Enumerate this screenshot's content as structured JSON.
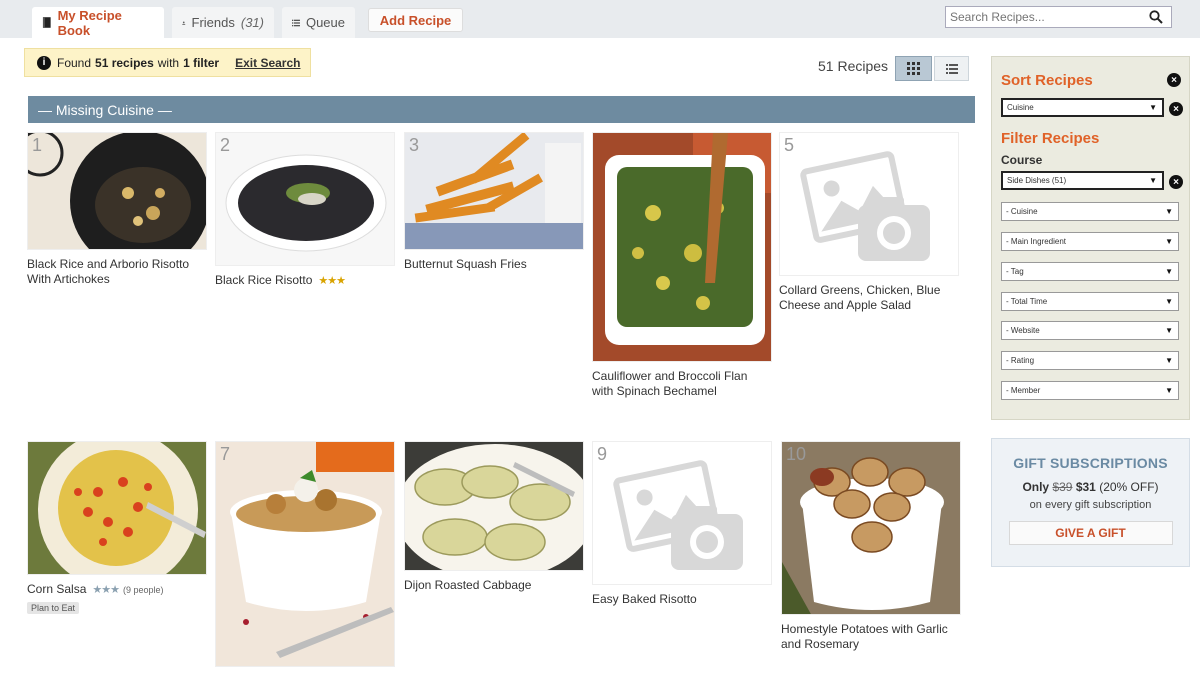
{
  "nav": {
    "tabs": [
      {
        "label": "My Recipe Book"
      },
      {
        "label": "Friends",
        "count": "(31)"
      },
      {
        "label": "Queue"
      }
    ],
    "add_recipe": "Add Recipe",
    "search_placeholder": "Search Recipes..."
  },
  "search_summary": {
    "found_prefix": "Found",
    "found_count": "51 recipes",
    "with_text": "with",
    "filter_count": "1 filter",
    "exit_label": "Exit Search"
  },
  "recipe_count": "51 Recipes",
  "section_title": "— Missing Cuisine —",
  "recipes": [
    {
      "num": "1",
      "title": "Black Rice and Arborio Risotto With Artichokes"
    },
    {
      "num": "2",
      "title": "Black Rice Risotto",
      "stars": "★★★"
    },
    {
      "num": "3",
      "title": "Butternut Squash Fries"
    },
    {
      "num": "",
      "title": "Cauliflower and Broccoli Flan with Spinach Bechamel"
    },
    {
      "num": "5",
      "title": "Collard Greens, Chicken, Blue Cheese and Apple Salad"
    },
    {
      "num": "",
      "title": "Corn Salsa",
      "stars": "★★★",
      "people": "(9 people)",
      "badge": "Plan to Eat"
    },
    {
      "num": "7",
      "title": ""
    },
    {
      "num": "",
      "title": "Dijon Roasted Cabbage"
    },
    {
      "num": "9",
      "title": "Easy Baked Risotto"
    },
    {
      "num": "10",
      "title": "Homestyle Potatoes with Garlic and Rosemary"
    }
  ],
  "sidebar": {
    "sort_heading": "Sort Recipes",
    "sort_value": "Cuisine",
    "filter_heading": "Filter Recipes",
    "course_label": "Course",
    "course_value": "Side Dishes (51)",
    "filters": [
      "- Cuisine",
      "- Main Ingredient",
      "- Tag",
      "- Total Time",
      "- Website",
      "- Rating",
      "- Member"
    ]
  },
  "gift": {
    "title": "GIFT SUBSCRIPTIONS",
    "only": "Only",
    "old_price": "$39",
    "new_price": "$31",
    "discount": "(20% OFF)",
    "line2": "on every gift subscription",
    "button": "GIVE A GIFT"
  },
  "colors": {
    "accent": "#c8502a",
    "section_bar": "#6e8ba0",
    "sidebar_bg": "#ebebe0"
  }
}
